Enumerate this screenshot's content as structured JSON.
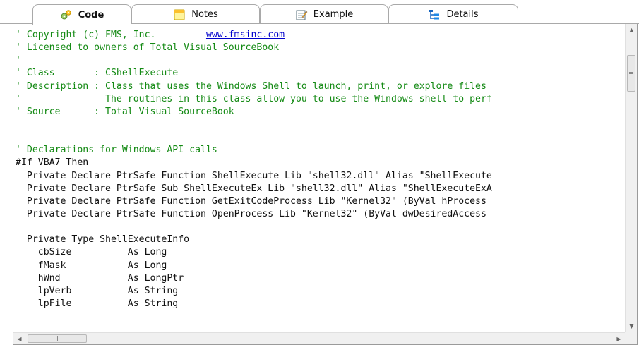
{
  "tabs": [
    {
      "label": "Code",
      "icon": "code-icon",
      "active": true
    },
    {
      "label": "Notes",
      "icon": "notes-icon",
      "active": false
    },
    {
      "label": "Example",
      "icon": "example-icon",
      "active": false
    },
    {
      "label": "Details",
      "icon": "details-icon",
      "active": false
    }
  ],
  "code_lines": [
    {
      "kind": "comment",
      "text": "' Copyright (c) FMS, Inc.         ",
      "url": "www.fmsinc.com"
    },
    {
      "kind": "comment",
      "text": "' Licensed to owners of Total Visual SourceBook"
    },
    {
      "kind": "comment",
      "text": "'"
    },
    {
      "kind": "comment",
      "text": "' Class       : CShellExecute"
    },
    {
      "kind": "comment",
      "text": "' Description : Class that uses the Windows Shell to launch, print, or explore files"
    },
    {
      "kind": "comment",
      "text": "'               The routines in this class allow you to use the Windows shell to perf"
    },
    {
      "kind": "comment",
      "text": "' Source      : Total Visual SourceBook"
    },
    {
      "kind": "blank",
      "text": ""
    },
    {
      "kind": "blank",
      "text": ""
    },
    {
      "kind": "comment",
      "text": "' Declarations for Windows API calls"
    },
    {
      "kind": "code",
      "text": "#If VBA7 Then"
    },
    {
      "kind": "code",
      "text": "  Private Declare PtrSafe Function ShellExecute Lib \"shell32.dll\" Alias \"ShellExecute"
    },
    {
      "kind": "code",
      "text": "  Private Declare PtrSafe Sub ShellExecuteEx Lib \"shell32.dll\" Alias \"ShellExecuteExA"
    },
    {
      "kind": "code",
      "text": "  Private Declare PtrSafe Function GetExitCodeProcess Lib \"Kernel32\" (ByVal hProcess"
    },
    {
      "kind": "code",
      "text": "  Private Declare PtrSafe Function OpenProcess Lib \"Kernel32\" (ByVal dwDesiredAccess"
    },
    {
      "kind": "blank",
      "text": ""
    },
    {
      "kind": "code",
      "text": "  Private Type ShellExecuteInfo"
    },
    {
      "kind": "code",
      "text": "    cbSize          As Long"
    },
    {
      "kind": "code",
      "text": "    fMask           As Long"
    },
    {
      "kind": "code",
      "text": "    hWnd            As LongPtr"
    },
    {
      "kind": "code",
      "text": "    lpVerb          As String"
    },
    {
      "kind": "code",
      "text": "    lpFile          As String"
    }
  ],
  "scrollbar": {
    "up_glyph": "▲",
    "down_glyph": "▼",
    "left_glyph": "◀",
    "right_glyph": "▶"
  },
  "colors": {
    "comment": "#148a14",
    "code": "#111111",
    "link": "#0000cc"
  }
}
